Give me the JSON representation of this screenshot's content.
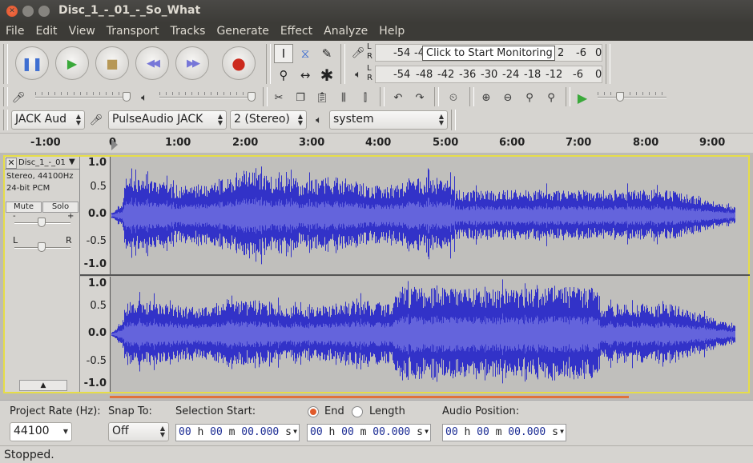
{
  "window": {
    "title": "Disc_1_-_01_-_So_What"
  },
  "menu": [
    "File",
    "Edit",
    "View",
    "Transport",
    "Tracks",
    "Generate",
    "Effect",
    "Analyze",
    "Help"
  ],
  "transport": {
    "buttons": [
      {
        "name": "pause-button",
        "icon": "pause-icon",
        "glyph": "❚❚"
      },
      {
        "name": "play-button",
        "icon": "play-icon",
        "glyph": "▶"
      },
      {
        "name": "stop-button",
        "icon": "stop-icon",
        "glyph": "■"
      },
      {
        "name": "skip-start-button",
        "icon": "skip-start-icon",
        "glyph": "◀◀"
      },
      {
        "name": "skip-end-button",
        "icon": "skip-end-icon",
        "glyph": "▶▶"
      },
      {
        "name": "record-button",
        "icon": "record-icon",
        "glyph": "●"
      }
    ]
  },
  "meters": {
    "record_tip": "Click to Start Monitoring",
    "record_ticks": [
      "-54",
      "-4",
      "2",
      "-6",
      "0"
    ],
    "play_ticks": [
      "-54",
      "-48",
      "-42",
      "-36",
      "-30",
      "-24",
      "-18",
      "-12",
      "-6",
      "0"
    ],
    "lr_left": "L",
    "lr_right": "R"
  },
  "device": {
    "host": "JACK Aud",
    "input": "PulseAudio JACK",
    "channels": "2 (Stereo)",
    "output": "system"
  },
  "ruler": {
    "labels": [
      "-1:00",
      "0",
      "1:00",
      "2:00",
      "3:00",
      "4:00",
      "5:00",
      "6:00",
      "7:00",
      "8:00",
      "9:00"
    ]
  },
  "track": {
    "name": "Disc_1_-_01",
    "format": "Stereo, 44100Hz",
    "bit_depth": "24-bit PCM",
    "mute": "Mute",
    "solo": "Solo",
    "gain_minus": "-",
    "gain_plus": "+",
    "pan_left": "L",
    "pan_right": "R",
    "close": "✕",
    "menu_arrow": "▼",
    "collapse": "▲",
    "amplitude_labels": [
      "1.0",
      "0.5",
      "0.0",
      "-0.5",
      "-1.0"
    ]
  },
  "selection": {
    "project_rate_label": "Project Rate (Hz):",
    "project_rate": "44100",
    "snap_label": "Snap To:",
    "snap_value": "Off",
    "start_label": "Selection Start:",
    "end_label": "End",
    "length_label": "Length",
    "end_selected": true,
    "position_label": "Audio Position:",
    "start_time": [
      "00",
      "00",
      "00.000"
    ],
    "end_time": [
      "00",
      "00",
      "00.000"
    ],
    "position_time": [
      "00",
      "00",
      "00.000"
    ],
    "unit_h": "h",
    "unit_m": "m",
    "unit_s": "s"
  },
  "status": "Stopped.",
  "colors": {
    "waveform": "#3232c8",
    "waveform_rms": "#6464dc",
    "selection_border": "#e6dd48",
    "record_red": "#cc2a1d"
  }
}
